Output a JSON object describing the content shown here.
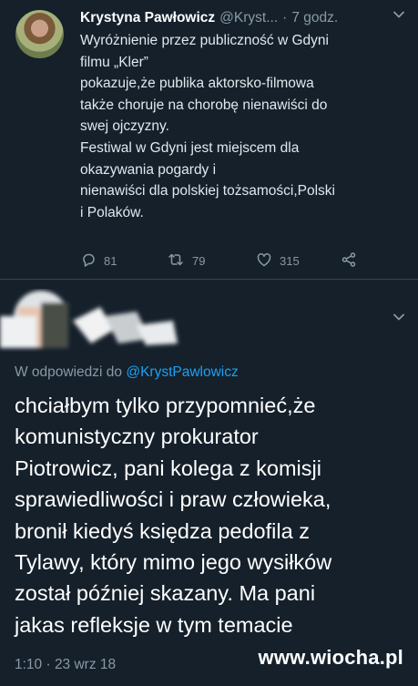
{
  "tweet1": {
    "name": "Krystyna Pawłowicz",
    "handle": "@Kryst...",
    "separator": "·",
    "time": "7 godz.",
    "text_lines": [
      "Wyróżnienie przez publiczność w Gdyni",
      "filmu „Kler”",
      "pokazuje,że publika aktorsko-filmowa",
      "także choruje na chorobę nienawiści do",
      "swej ojczyzny.",
      "Festiwal w Gdyni jest miejscem dla",
      "okazywania pogardy i",
      "nienawiści dla polskiej tożsamości,Polski",
      "i Polaków."
    ],
    "replies": "81",
    "retweets": "79",
    "likes": "315",
    "icons": [
      "reply-icon",
      "retweet-icon",
      "like-icon",
      "share-icon",
      "chevron-down-icon"
    ]
  },
  "tweet2": {
    "reply_prefix": "W odpowiedzi do",
    "reply_mention": "@KrystPawlowicz",
    "text_lines": [
      "chciałbym tylko przypomnieć,że",
      "komunistyczny prokurator",
      "Piotrowicz, pani kolega z komisji",
      "sprawiedliwości i praw człowieka,",
      "bronił kiedyś księdza pedofila z",
      "Tylawy, który mimo jego wysiłków",
      "został później skazany. Ma pani",
      "jakas refleksje w tym temacie"
    ],
    "timestamp": "1:10 · 23 wrz 18"
  },
  "watermark": "www.wiocha.pl",
  "colors": {
    "background": "#15202b",
    "muted": "#8899a6",
    "link": "#1da1f2",
    "divider": "#38444d"
  }
}
